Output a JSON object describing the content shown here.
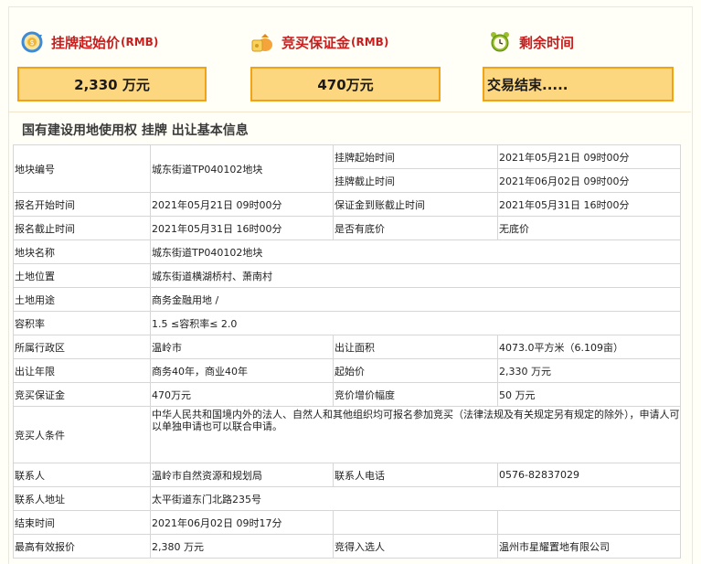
{
  "summary": {
    "start_price": {
      "title": "挂牌起始价",
      "unit": "(RMB)",
      "value": "2,330 万元",
      "icon": "refresh-coin-icon"
    },
    "deposit": {
      "title": "竞买保证金",
      "unit": "(RMB)",
      "value": "470万元",
      "icon": "money-bag-icon"
    },
    "remaining": {
      "title": "剩余时间",
      "value": "交易结束.....",
      "icon": "alarm-clock-icon"
    }
  },
  "section_title": "国有建设用地使用权 挂牌 出让基本信息",
  "info": {
    "plot_no_label": "地块编号",
    "plot_no": "城东街道TP040102地块",
    "listing_start_label": "挂牌起始时间",
    "listing_start": "2021年05月21日 09时00分",
    "listing_end_label": "挂牌截止时间",
    "listing_end": "2021年06月02日 09时00分",
    "reg_start_label": "报名开始时间",
    "reg_start": "2021年05月21日 09时00分",
    "deposit_deadline_label": "保证金到账截止时间",
    "deposit_deadline": "2021年05月31日 16时00分",
    "reg_end_label": "报名截止时间",
    "reg_end": "2021年05月31日 16时00分",
    "reserve_label": "是否有底价",
    "reserve": "无底价",
    "name_label": "地块名称",
    "name": "城东街道TP040102地块",
    "location_label": "土地位置",
    "location": "城东街道横湖桥村、萧南村",
    "use_label": "土地用途",
    "use": "商务金融用地 /",
    "far_label": "容积率",
    "far": "1.5 ≤容积率≤ 2.0",
    "district_label": "所属行政区",
    "district": "温岭市",
    "area_label": "出让面积",
    "area": "4073.0平方米（6.109亩）",
    "term_label": "出让年限",
    "term": "商务40年，商业40年",
    "start_price_label": "起始价",
    "start_price": "2,330 万元",
    "deposit_label": "竞买保证金",
    "deposit": "470万元",
    "increment_label": "竞价增价幅度",
    "increment": "50 万元",
    "conditions_label": "竞买人条件",
    "conditions": "中华人民共和国境内外的法人、自然人和其他组织均可报名参加竞买（法律法规及有关规定另有规定的除外），申请人可以单独申请也可以联合申请。",
    "contact_label": "联系人",
    "contact": "温岭市自然资源和规划局",
    "phone_label": "联系人电话",
    "phone": "0576-82837029",
    "address_label": "联系人地址",
    "address": "太平街道东门北路235号",
    "end_time_label": "结束时间",
    "end_time": "2021年06月02日 09时17分",
    "highest_bid_label": "最高有效报价",
    "highest_bid": "2,380 万元",
    "winner_label": "竞得入选人",
    "winner": "温州市星耀置地有限公司"
  }
}
